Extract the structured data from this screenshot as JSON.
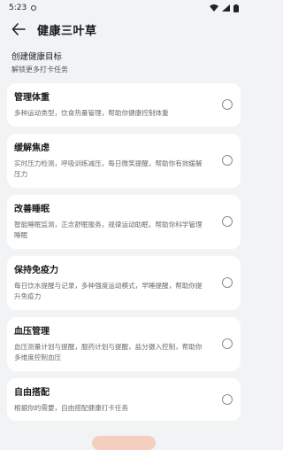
{
  "status": {
    "time": "5:23"
  },
  "header": {
    "title": "健康三叶草"
  },
  "intro": {
    "title": "创建健康目标",
    "subtitle": "解锁更多打卡任务"
  },
  "cards": [
    {
      "title": "管理体重",
      "desc": "多种运动类型，饮食热量管理，帮助你健康控制体重"
    },
    {
      "title": "缓解焦虑",
      "desc": "实时压力检测，呼吸训练减压，每日微笑提醒，帮助你有效缓解压力"
    },
    {
      "title": "改善睡眠",
      "desc": "智能睡眠监测，正念舒眠服务，规律运动助眠，帮助你科学管理睡眠"
    },
    {
      "title": "保持免疫力",
      "desc": "每日饮水提醒与记录，多种强度运动模式，早睡提醒，帮助你提升免疫力"
    },
    {
      "title": "血压管理",
      "desc": "血压测量计划与提醒，服药计划与提醒，盐分摄入控制，帮助你多维度控制血压"
    },
    {
      "title": "自由搭配",
      "desc": "根据你的需要，自由搭配健康打卡任务"
    }
  ]
}
